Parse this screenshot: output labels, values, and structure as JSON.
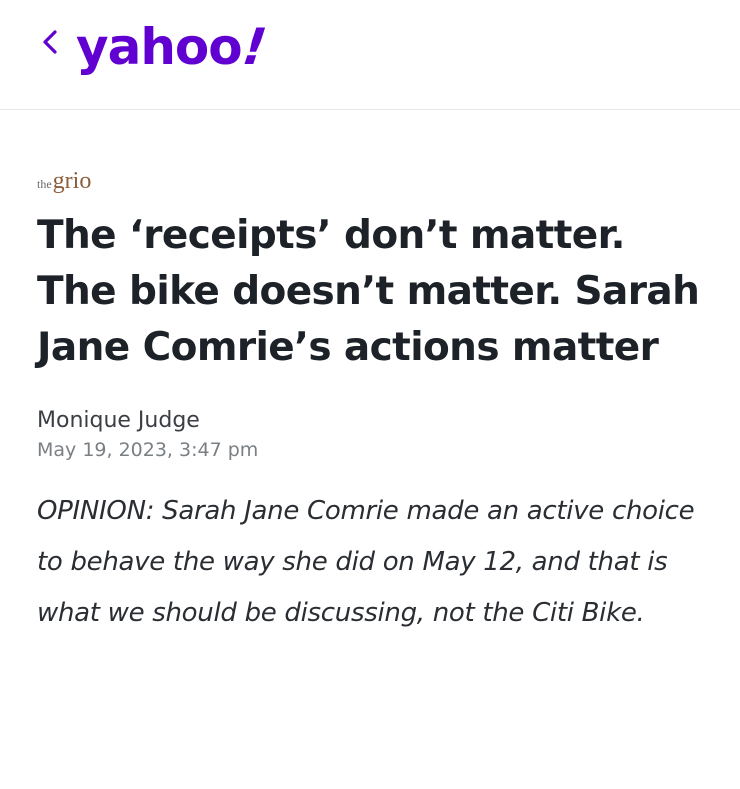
{
  "header": {
    "logo_text": "yahoo",
    "logo_bang": "!",
    "back_icon": "chevron-left-icon",
    "brand_color": "#6001d2"
  },
  "article": {
    "source_prefix": "the",
    "source_name": "grio",
    "headline": "The ‘receipts’ don’t matter. The bike doesn’t matter. Sarah Jane Comrie’s actions matter",
    "author": "Monique Judge",
    "date": "May 19, 2023, 3:47 pm",
    "summary": "OPINION: Sarah Jane Comrie made an active choice to behave the way she did on May 12, and that is what we should be discussing, not the Citi Bike."
  }
}
